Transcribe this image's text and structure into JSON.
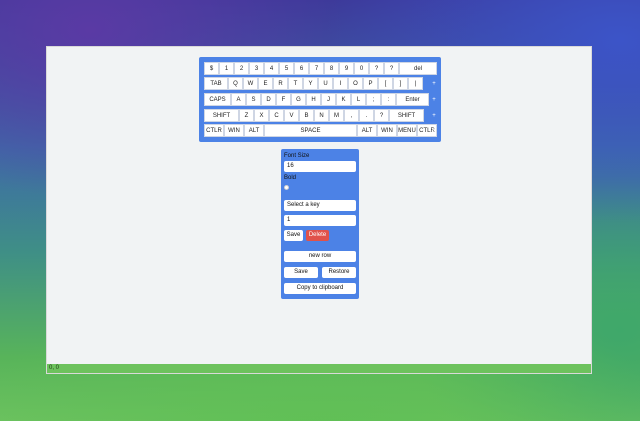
{
  "keyboard": {
    "rows": [
      [
        "$",
        "1",
        "2",
        "3",
        "4",
        "5",
        "6",
        "7",
        "8",
        "9",
        "0",
        "?",
        "?",
        "del"
      ],
      [
        "TAB",
        "Q",
        "W",
        "E",
        "R",
        "T",
        "Y",
        "U",
        "I",
        "O",
        "P",
        "[",
        "]",
        "|"
      ],
      [
        "CAPS",
        "A",
        "S",
        "D",
        "F",
        "G",
        "H",
        "J",
        "K",
        "L",
        ";",
        ":",
        "Enter"
      ],
      [
        "SHIFT",
        "Z",
        "X",
        "C",
        "V",
        "B",
        "N",
        "M",
        ",",
        ".",
        "?",
        "SHIFT"
      ],
      [
        "CTLR",
        "WIN",
        "ALT",
        "SPACE",
        "ALT",
        "WIN",
        "MENU",
        "CTLR"
      ]
    ],
    "row_add_symbol": "+"
  },
  "panel": {
    "font_size_label": "Font Size",
    "font_size_value": "16",
    "bold_label": "Bold",
    "select_key_placeholder": "Select a key",
    "key_width_value": "1",
    "save_key_label": "Save",
    "delete_key_label": "Delete",
    "new_row_label": "new row",
    "save_label": "Save",
    "restore_label": "Restore",
    "copy_label": "Copy to clipboard"
  },
  "status": {
    "coords": "0, 0"
  },
  "colors": {
    "accent": "#4c82e6",
    "delete": "#e0524a",
    "statusbar": "#6dc25d"
  }
}
